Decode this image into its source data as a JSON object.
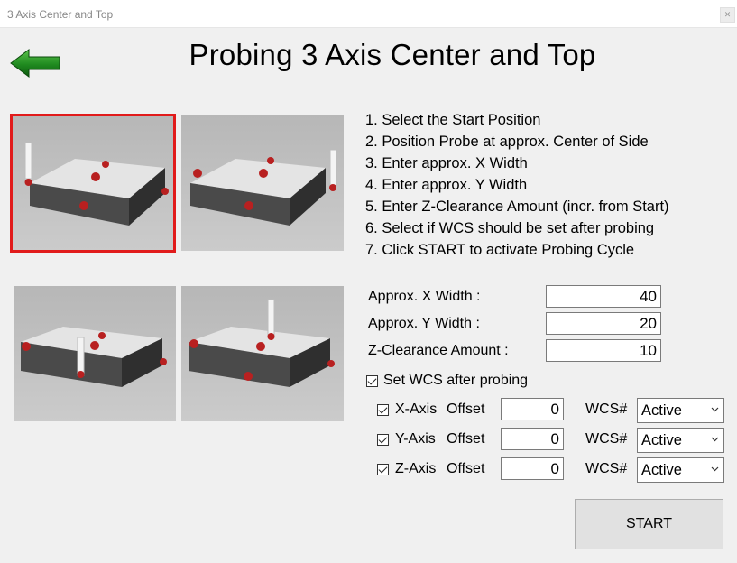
{
  "window": {
    "title": "3 Axis Center and Top",
    "close_icon": "x-icon"
  },
  "header": {
    "title": "Probing 3 Axis Center and Top",
    "back_icon": "back-arrow-icon",
    "back_color": "#1f8a1f"
  },
  "positions": {
    "selected_index": 0,
    "count": 4,
    "selected_color": "#e11b1b"
  },
  "instructions": [
    "1. Select the Start Position",
    "2. Position Probe at approx. Center of Side",
    "3. Enter approx. X Width",
    "4. Enter approx. Y Width",
    "5. Enter Z-Clearance Amount (incr. from Start)",
    "6. Select if WCS should be set after probing",
    "7. Click START to activate Probing Cycle"
  ],
  "inputs": {
    "x_width": {
      "label": "Approx. X Width :",
      "value": "40"
    },
    "y_width": {
      "label": "Approx. Y Width :",
      "value": "20"
    },
    "z_clearance": {
      "label": "Z-Clearance Amount :",
      "value": "10"
    }
  },
  "set_wcs": {
    "label": "Set WCS after probing",
    "checked": true
  },
  "offsets": [
    {
      "axis": "X-Axis",
      "label": "Offset",
      "checked": true,
      "value": "0",
      "wcs_label": "WCS#",
      "wcs_value": "Active"
    },
    {
      "axis": "Y-Axis",
      "label": "Offset",
      "checked": true,
      "value": "0",
      "wcs_label": "WCS#",
      "wcs_value": "Active"
    },
    {
      "axis": "Z-Axis",
      "label": "Offset",
      "checked": true,
      "value": "0",
      "wcs_label": "WCS#",
      "wcs_value": "Active"
    }
  ],
  "start_button": {
    "label": "START"
  }
}
